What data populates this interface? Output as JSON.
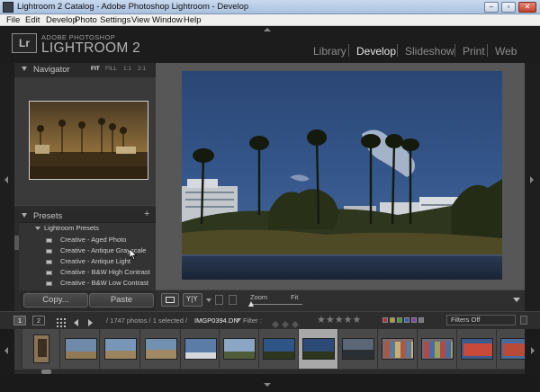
{
  "window": {
    "title": "Lightroom 2 Catalog - Adobe Photoshop Lightroom - Develop",
    "minimize": "–",
    "maximize": "▫",
    "close": "✕"
  },
  "menu": [
    "File",
    "Edit",
    "Develop",
    "Photo",
    "Settings",
    "View",
    "Window",
    "Help"
  ],
  "identity": {
    "logo": "Lr",
    "brand_top": "ADOBE PHOTOSHOP",
    "brand_main": "LIGHTROOM 2"
  },
  "modules": [
    "Library",
    "Develop",
    "Slideshow",
    "Print",
    "Web"
  ],
  "active_module": "Develop",
  "navigator": {
    "title": "Navigator",
    "zoom_options": [
      "FIT",
      "FILL",
      "1:1",
      "2:1"
    ],
    "active_zoom": "FIT"
  },
  "presets": {
    "title": "Presets",
    "add": "+",
    "folder": "Lightroom Presets",
    "items": [
      "Creative - Aged Photo",
      "Creative - Antique Grayscale",
      "Creative - Antique Light",
      "Creative - B&W High Contrast",
      "Creative - B&W Low Contrast"
    ]
  },
  "buttons": {
    "copy": "Copy...",
    "paste": "Paste"
  },
  "toolbar": {
    "zoom_label": "Zoom",
    "fit_label": "Fit"
  },
  "filmstrip_bar": {
    "screen1": "1",
    "screen2": "2",
    "photo_count": "/ 1747 photos / 1 selected /",
    "filename": "IMGP0394.DN",
    "filter_label": "Filter :",
    "stars": "★★★★★",
    "filter_value": "Filters Off"
  },
  "colors": {
    "accent_active": "#e6e6e6",
    "panel_bg": "#333333",
    "selected_cell": "#a8a8a8"
  },
  "icons": {
    "grid": "grid-icon",
    "back": "arrow-left-icon",
    "forward": "arrow-right-icon",
    "toolbar_menu": "triangle-down-icon"
  }
}
